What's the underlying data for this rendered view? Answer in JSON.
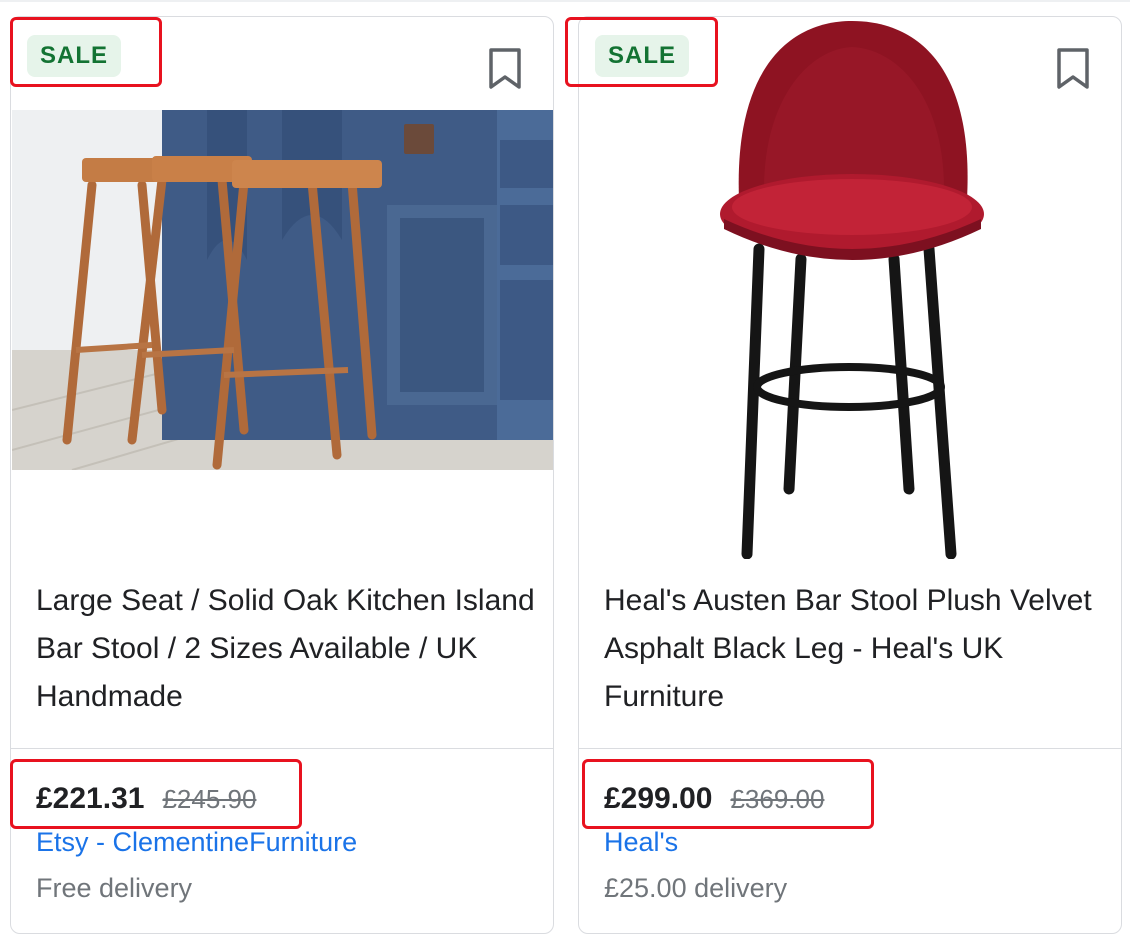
{
  "products": [
    {
      "badge": "SALE",
      "title": "Large Seat / Solid Oak Kitchen Island Bar Stool / 2 Sizes Available / UK Handmade",
      "price": "£221.31",
      "old_price": "£245.90",
      "seller": "Etsy - ClementineFurniture",
      "delivery": "Free delivery",
      "image": "oak-bar-stools-photo"
    },
    {
      "badge": "SALE",
      "title": "Heal's Austen Bar Stool Plush Velvet Asphalt Black Leg - Heal's UK Furniture",
      "price": "£299.00",
      "old_price": "£369.00",
      "seller": "Heal's",
      "delivery": "£25.00 delivery",
      "image": "red-velvet-bar-stool-photo"
    }
  ],
  "icons": {
    "save": "bookmark-icon"
  },
  "colors": {
    "sale_badge_bg": "#e6f4ea",
    "sale_badge_text": "#137333",
    "highlight": "#e8121f",
    "seller_link": "#1a73e8",
    "muted": "#70757a"
  }
}
